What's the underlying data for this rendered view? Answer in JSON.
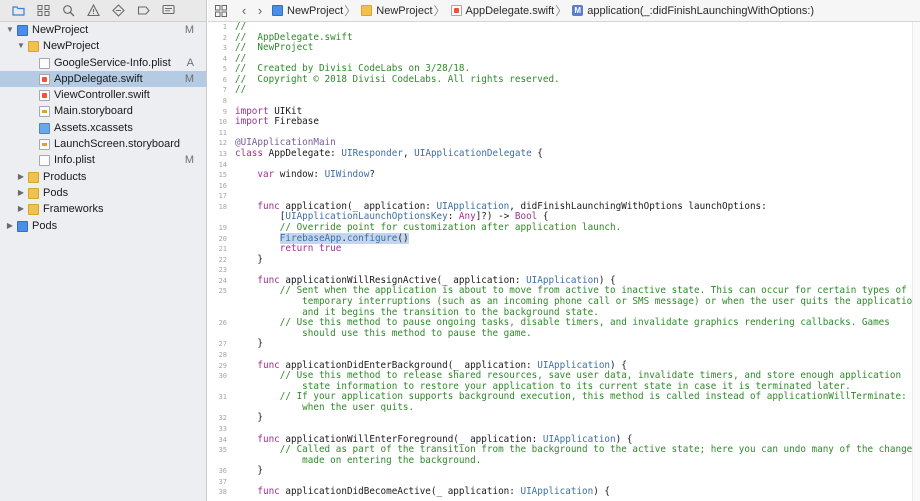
{
  "navigator": {
    "toolbar_icons": [
      "folder-icon",
      "hierarchy-icon",
      "search-icon",
      "warning-icon",
      "diamond-icon",
      "breakpoint-icon",
      "chat-icon"
    ],
    "tree": [
      {
        "label": "NewProject",
        "badge": "M",
        "indent": 0,
        "icon": "project-icon",
        "disclosure": "▼",
        "selected": false
      },
      {
        "label": "NewProject",
        "badge": "",
        "indent": 1,
        "icon": "folder-icon",
        "disclosure": "▼",
        "selected": false
      },
      {
        "label": "GoogleService-Info.plist",
        "badge": "A",
        "indent": 2,
        "icon": "plist-file-icon",
        "disclosure": "",
        "selected": false
      },
      {
        "label": "AppDelegate.swift",
        "badge": "M",
        "indent": 2,
        "icon": "swift-file-icon",
        "disclosure": "",
        "selected": true
      },
      {
        "label": "ViewController.swift",
        "badge": "",
        "indent": 2,
        "icon": "swift-file-icon",
        "disclosure": "",
        "selected": false
      },
      {
        "label": "Main.storyboard",
        "badge": "",
        "indent": 2,
        "icon": "storyboard-file-icon",
        "disclosure": "",
        "selected": false
      },
      {
        "label": "Assets.xcassets",
        "badge": "",
        "indent": 2,
        "icon": "assets-folder-icon",
        "disclosure": "",
        "selected": false
      },
      {
        "label": "LaunchScreen.storyboard",
        "badge": "",
        "indent": 2,
        "icon": "storyboard-file-icon",
        "disclosure": "",
        "selected": false
      },
      {
        "label": "Info.plist",
        "badge": "M",
        "indent": 2,
        "icon": "plist-file-icon",
        "disclosure": "",
        "selected": false
      },
      {
        "label": "Products",
        "badge": "",
        "indent": 1,
        "icon": "folder-icon",
        "disclosure": "▶",
        "selected": false
      },
      {
        "label": "Pods",
        "badge": "",
        "indent": 1,
        "icon": "folder-icon",
        "disclosure": "▶",
        "selected": false
      },
      {
        "label": "Frameworks",
        "badge": "",
        "indent": 1,
        "icon": "folder-icon",
        "disclosure": "▶",
        "selected": false
      },
      {
        "label": "Pods",
        "badge": "",
        "indent": 0,
        "icon": "project-icon",
        "disclosure": "▶",
        "selected": false
      }
    ]
  },
  "jumpbar": {
    "crumbs": [
      "NewProject",
      "NewProject",
      "AppDelegate.swift"
    ],
    "method_badge": "M",
    "method": "application(_:didFinishLaunchingWithOptions:)"
  },
  "code_lines": [
    {
      "n": "1",
      "t": "//"
    },
    {
      "n": "2",
      "t": "//  AppDelegate.swift"
    },
    {
      "n": "3",
      "t": "//  NewProject"
    },
    {
      "n": "4",
      "t": "//"
    },
    {
      "n": "5",
      "t": "//  Created by Divisi CodeLabs on 3/28/18."
    },
    {
      "n": "6",
      "t": "//  Copyright © 2018 Divisi CodeLabs. All rights reserved."
    },
    {
      "n": "7",
      "t": "//"
    },
    {
      "n": "8",
      "t": ""
    },
    {
      "n": "9",
      "t": "import UIKit"
    },
    {
      "n": "10",
      "t": "import Firebase"
    },
    {
      "n": "11",
      "t": ""
    },
    {
      "n": "12",
      "t": "@UIApplicationMain"
    },
    {
      "n": "13",
      "t": "class AppDelegate: UIResponder, UIApplicationDelegate {"
    },
    {
      "n": "14",
      "t": ""
    },
    {
      "n": "15",
      "t": "    var window: UIWindow?"
    },
    {
      "n": "16",
      "t": ""
    },
    {
      "n": "17",
      "t": ""
    },
    {
      "n": "18",
      "t": "    func application(_ application: UIApplication, didFinishLaunchingWithOptions launchOptions:"
    },
    {
      "n": "",
      "t": "        [UIApplicationLaunchOptionsKey: Any]?) -> Bool {"
    },
    {
      "n": "19",
      "t": "        // Override point for customization after application launch."
    },
    {
      "n": "20",
      "t": "        FirebaseApp.configure()"
    },
    {
      "n": "21",
      "t": "        return true"
    },
    {
      "n": "22",
      "t": "    }"
    },
    {
      "n": "23",
      "t": ""
    },
    {
      "n": "24",
      "t": "    func applicationWillResignActive(_ application: UIApplication) {"
    },
    {
      "n": "25",
      "t": "        // Sent when the application is about to move from active to inactive state. This can occur for certain types of"
    },
    {
      "n": "",
      "t": "            temporary interruptions (such as an incoming phone call or SMS message) or when the user quits the application"
    },
    {
      "n": "",
      "t": "            and it begins the transition to the background state."
    },
    {
      "n": "26",
      "t": "        // Use this method to pause ongoing tasks, disable timers, and invalidate graphics rendering callbacks. Games"
    },
    {
      "n": "",
      "t": "            should use this method to pause the game."
    },
    {
      "n": "27",
      "t": "    }"
    },
    {
      "n": "28",
      "t": ""
    },
    {
      "n": "29",
      "t": "    func applicationDidEnterBackground(_ application: UIApplication) {"
    },
    {
      "n": "30",
      "t": "        // Use this method to release shared resources, save user data, invalidate timers, and store enough application"
    },
    {
      "n": "",
      "t": "            state information to restore your application to its current state in case it is terminated later."
    },
    {
      "n": "31",
      "t": "        // If your application supports background execution, this method is called instead of applicationWillTerminate:"
    },
    {
      "n": "",
      "t": "            when the user quits."
    },
    {
      "n": "32",
      "t": "    }"
    },
    {
      "n": "33",
      "t": ""
    },
    {
      "n": "34",
      "t": "    func applicationWillEnterForeground(_ application: UIApplication) {"
    },
    {
      "n": "35",
      "t": "        // Called as part of the transition from the background to the active state; here you can undo many of the changes"
    },
    {
      "n": "",
      "t": "            made on entering the background."
    },
    {
      "n": "36",
      "t": "    }"
    },
    {
      "n": "37",
      "t": ""
    },
    {
      "n": "38",
      "t": "    func applicationDidBecomeActive(_ application: UIApplication) {"
    }
  ],
  "highlight_text": "FirebaseApp.configure()",
  "colors": {
    "comment": "#2f8a2a",
    "keyword": "#a52e91",
    "type": "#3d6fa6",
    "selection": "#b5cbe4"
  }
}
